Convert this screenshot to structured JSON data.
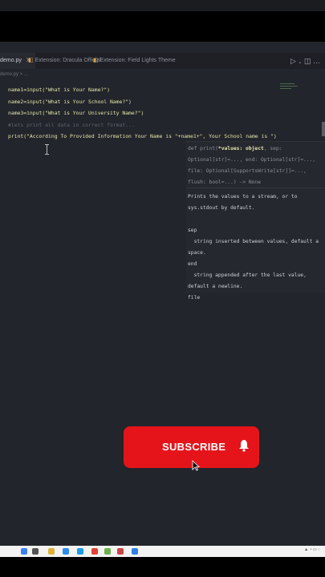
{
  "tabs": [
    {
      "label": "demo.py",
      "close": "X",
      "active": true
    },
    {
      "label": "Extension: Dracula Official",
      "active": false
    },
    {
      "label": "Extension: Field Lights Theme",
      "active": false
    }
  ],
  "breadcrumb": "demo.py > ...",
  "code_lines": [
    "name1=input(\"What is Your Name?\")",
    "name2=input(\"What is Your School Name?\")",
    "name3=input(\"What is Your University Name?\")",
    "#lets print all data in correct format...",
    "print(\"According To Provided Information Your Name is \"+name1+\", Your School name is \")"
  ],
  "hover": {
    "sig_prefix": "def print(",
    "sig_param": "*values: object",
    "sig_rest": ", sep: Optional[str]=..., end: Optional[str]=..., file: Optional[SupportsWrite[str]]=..., flush: bool=...) -> None",
    "doc": "Prints the values to a stream, or to sys.stdout by default.\n\nsep\n  string inserted between values, default a space.\nend\n  string appended after the last value, default a newline.\nfile"
  },
  "subscribe": {
    "label": "SUBSCRIBE"
  },
  "icons": [
    "run-icon",
    "split-editor-icon",
    "more-icon",
    "bell-icon",
    "pointer-icon"
  ],
  "colors": {
    "subscribe_red": "#e5141b",
    "editor_bg": "#22252b",
    "code_yellow": "#e6e6a8"
  }
}
